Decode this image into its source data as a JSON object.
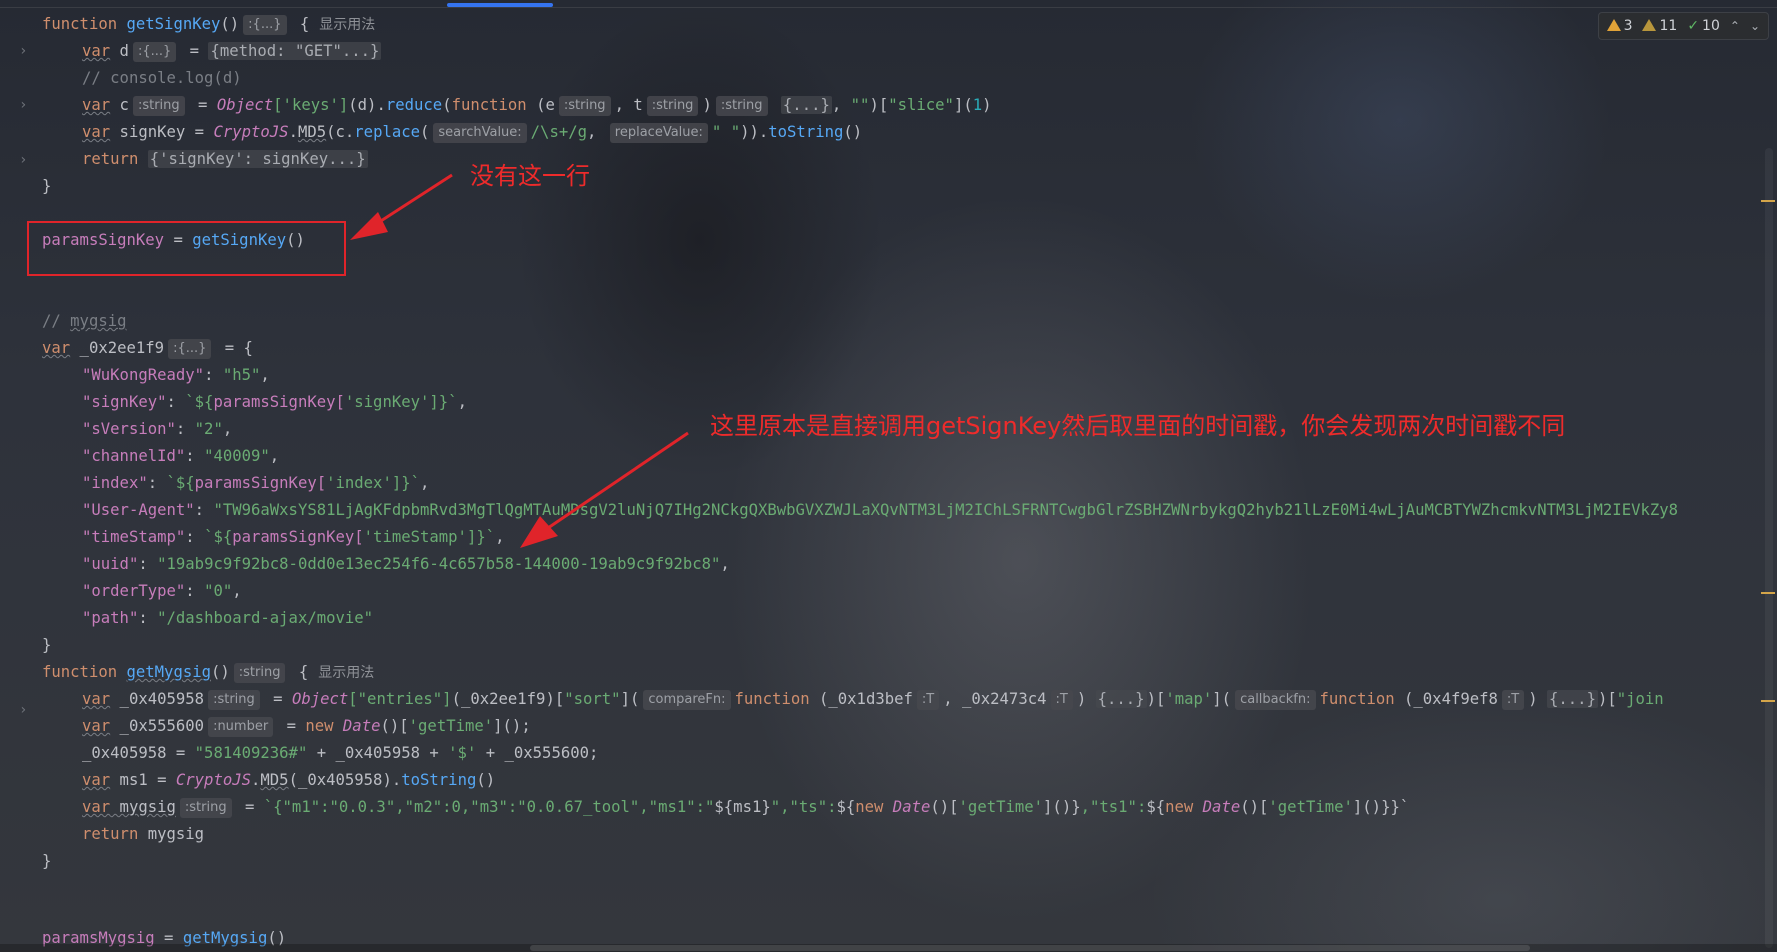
{
  "inspections": {
    "warnings": "3",
    "weak_warnings": "11",
    "ok": "10"
  },
  "hints": {
    "obj": ":{...}",
    "string": ":string",
    "number": ":number",
    "T": ":T",
    "searchValue": "searchValue:",
    "replaceValue": "replaceValue:",
    "compareFn": "compareFn:",
    "callbackFn": "callbackfn:",
    "usages": "显示用法"
  },
  "annotations": {
    "no_line": "没有这一行",
    "explanation": "这里原本是直接调用getSignKey然后取里面的时间戳，你会发现两次时间戳不同"
  },
  "code": {
    "l1_kw": "function",
    "l1_fn": "getSignKey",
    "l1_paren": "()",
    "l1_brace": "{",
    "l2_kw": "var",
    "l2_var": " d",
    "l2_eq": " = ",
    "l2_fold": "{method: \"GET\"...}",
    "l3": "// console.log(d)",
    "l4_kw": "var",
    "l4_var": " c",
    "l4_eq": " = ",
    "l4_obj": "Object",
    "l4_keys": "['keys']",
    "l4_d": "(d).",
    "l4_reduce": "reduce",
    "l4_open": "(",
    "l4_fnkw": "function",
    "l4_e": " (e",
    "l4_comma": ", t",
    "l4_close": ")",
    "l4_fold": "{...}",
    "l4_rest1": ", ",
    "l4_emptystr": "\"\"",
    "l4_rest2": ")[",
    "l4_slice": "\"slice\"",
    "l4_rest3": "](",
    "l4_one": "1",
    "l4_rest4": ")",
    "l5_kw": "var",
    "l5_var": " signKey = ",
    "l5_cls": "CryptoJS",
    "l5_dot": ".",
    "l5_md5": "MD5",
    "l5_c": "(c.",
    "l5_replace": "replace",
    "l5_open": "(",
    "l5_regex": "/\\s+/g",
    "l5_comma": ",",
    "l5_space": "\" \"",
    "l5_close": ")).",
    "l5_tostring": "toString",
    "l5_end": "()",
    "l6_kw": "return",
    "l6_fold": "{'signKey': signKey...}",
    "l7": "}",
    "l9_var": "paramsSignKey",
    "l9_eq": " = ",
    "l9_fn": "getSignKey",
    "l9_end": "()",
    "l12_cmt": "// ",
    "l12_name": "mygsig",
    "l13_kw": "var",
    "l13_var": " _0x2ee1f9",
    "l13_eq": " = {",
    "l14_k": "\"WuKongReady\"",
    "l14_v": "\"h5\"",
    "l15_k": "\"signKey\"",
    "l15_v1": "`${",
    "l15_v2": "paramsSignKey[",
    "l15_v3": "'signKey'",
    "l15_v4": "]}`",
    "l16_k": "\"sVersion\"",
    "l16_v": "\"2\"",
    "l17_k": "\"channelId\"",
    "l17_v": "\"40009\"",
    "l18_k": "\"index\"",
    "l18_v3": "'index'",
    "l19_k": "\"User-Agent\"",
    "l19_v": "\"TW96aWxsYS81LjAgKFdpbmRvd3MgTlQgMTAuMDsgV2luNjQ7IHg2NCkgQXBwbGVXZWJLaXQvNTM3LjM2IChLSFRNTCwgbGlrZSBHZWNrbykgQ2hyb21lLzE0Mi4wLjAuMCBTYWZhcmkvNTM3LjM2IEVkZy8",
    "l20_k": "\"timeStamp\"",
    "l20_v3": "'timeStamp'",
    "l21_k": "\"uuid\"",
    "l21_v": "\"19ab9c9f92bc8-0dd0e13ec254f6-4c657b58-144000-19ab9c9f92bc8\"",
    "l22_k": "\"orderType\"",
    "l22_v": "\"0\"",
    "l23_k": "\"path\"",
    "l23_v": "\"/dashboard-ajax/movie\"",
    "l24": "}",
    "l25_kw": "function",
    "l25_fn": "getMygsig",
    "l25_paren": "()",
    "l25_brace": "{",
    "l26_kw": "var",
    "l26_var": " _0x405958",
    "l26_eq": " = ",
    "l26_obj": "Object",
    "l26_entries": "[\"entries\"]",
    "l26_arg": "(_0x2ee1f9)[",
    "l26_sort": "\"sort\"",
    "l26_open": "](",
    "l26_fnkw": "function",
    "l26_a": " (_0x1d3bef",
    "l26_b": ", _0x2473c4",
    "l26_c": ")",
    "l26_fold": "{...}",
    "l26_d": ")[",
    "l26_map": "'map'",
    "l26_e": "](",
    "l26_fnkw2": "function",
    "l26_f": " (_0x4f9ef8",
    "l26_g": ")",
    "l26_fold2": "{...}",
    "l26_h": ")[",
    "l26_join": "\"join",
    "l27_kw": "var",
    "l27_var": " _0x555600",
    "l27_eq": " = ",
    "l27_new": "new",
    "l27_date": " Date",
    "l27_call": "()[",
    "l27_gt": "'getTime'",
    "l27_end": "]();",
    "l28_a": "_0x405958 = ",
    "l28_s": "\"581409236#\"",
    "l28_b": " + _0x405958 + ",
    "l28_d": "'$'",
    "l28_c": " + _0x555600;",
    "l29_kw": "var",
    "l29_var": " ms1 = ",
    "l29_cls": "CryptoJS",
    "l29_dot": ".",
    "l29_md5": "MD5",
    "l29_arg": "(_0x405958).",
    "l29_ts": "toString",
    "l29_end": "()",
    "l30_kw": "var",
    "l30_var": " mygsig",
    "l30_eq": " = ",
    "l30_t1": "`{\"m1\":\"0.0.3\",\"m2\":0,\"m3\":\"0.0.67_tool\",\"ms1\":\"",
    "l30_i1": "${ms1}",
    "l30_t2": "\",\"ts\":",
    "l30_i2a": "${",
    "l30_new": "new",
    "l30_date": " Date",
    "l30_i2b": "()[",
    "l30_gt": "'getTime'",
    "l30_i2c": "]()}",
    "l30_t3": ",\"ts1\":",
    "l30_i3c": "]()}}`",
    "l31_kw": "return",
    "l31_v": " mygsig",
    "l32": "}",
    "l34_var": "paramsMygsig",
    "l34_eq": " = ",
    "l34_fn": "getMygsig",
    "l34_end": "()"
  }
}
